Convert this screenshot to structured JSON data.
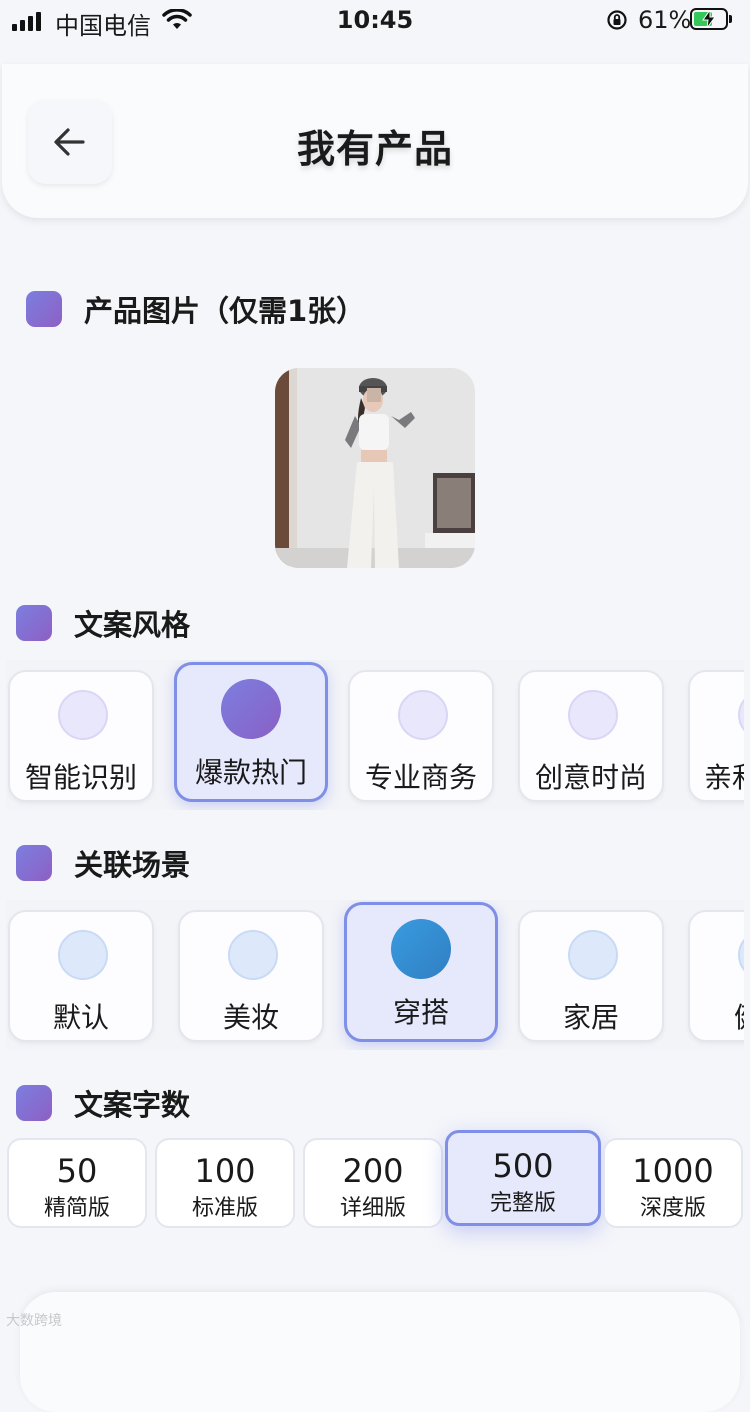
{
  "status_bar": {
    "carrier": "中国电信",
    "time": "10:45",
    "battery_percent": "61%",
    "battery_level": 0.61
  },
  "header": {
    "title": "我有产品",
    "back_icon": "arrow-left-icon"
  },
  "sections": {
    "product_image": "产品图片（仅需1张）",
    "copy_style": "文案风格",
    "scene": "关联场景",
    "word_count": "文案字数"
  },
  "styles": [
    {
      "label": "智能识别",
      "selected": false
    },
    {
      "label": "爆款热门",
      "selected": true
    },
    {
      "label": "专业商务",
      "selected": false
    },
    {
      "label": "创意时尚",
      "selected": false
    },
    {
      "label": "亲和",
      "selected": false
    }
  ],
  "scenes": [
    {
      "label": "默认",
      "selected": false
    },
    {
      "label": "美妆",
      "selected": false
    },
    {
      "label": "穿搭",
      "selected": true
    },
    {
      "label": "家居",
      "selected": false
    },
    {
      "label": "健",
      "selected": false
    }
  ],
  "word_counts": [
    {
      "value": "50",
      "label": "精简版",
      "selected": false
    },
    {
      "value": "100",
      "label": "标准版",
      "selected": false
    },
    {
      "value": "200",
      "label": "详细版",
      "selected": false
    },
    {
      "value": "500",
      "label": "完整版",
      "selected": true
    },
    {
      "value": "1000",
      "label": "深度版",
      "selected": false
    }
  ],
  "watermark": "大数跨境",
  "colors": {
    "accent": "#7f8ee6",
    "style_selected": "#7b7fdf",
    "scene_selected": "#3a9be0",
    "background": "#f5f6fa"
  }
}
